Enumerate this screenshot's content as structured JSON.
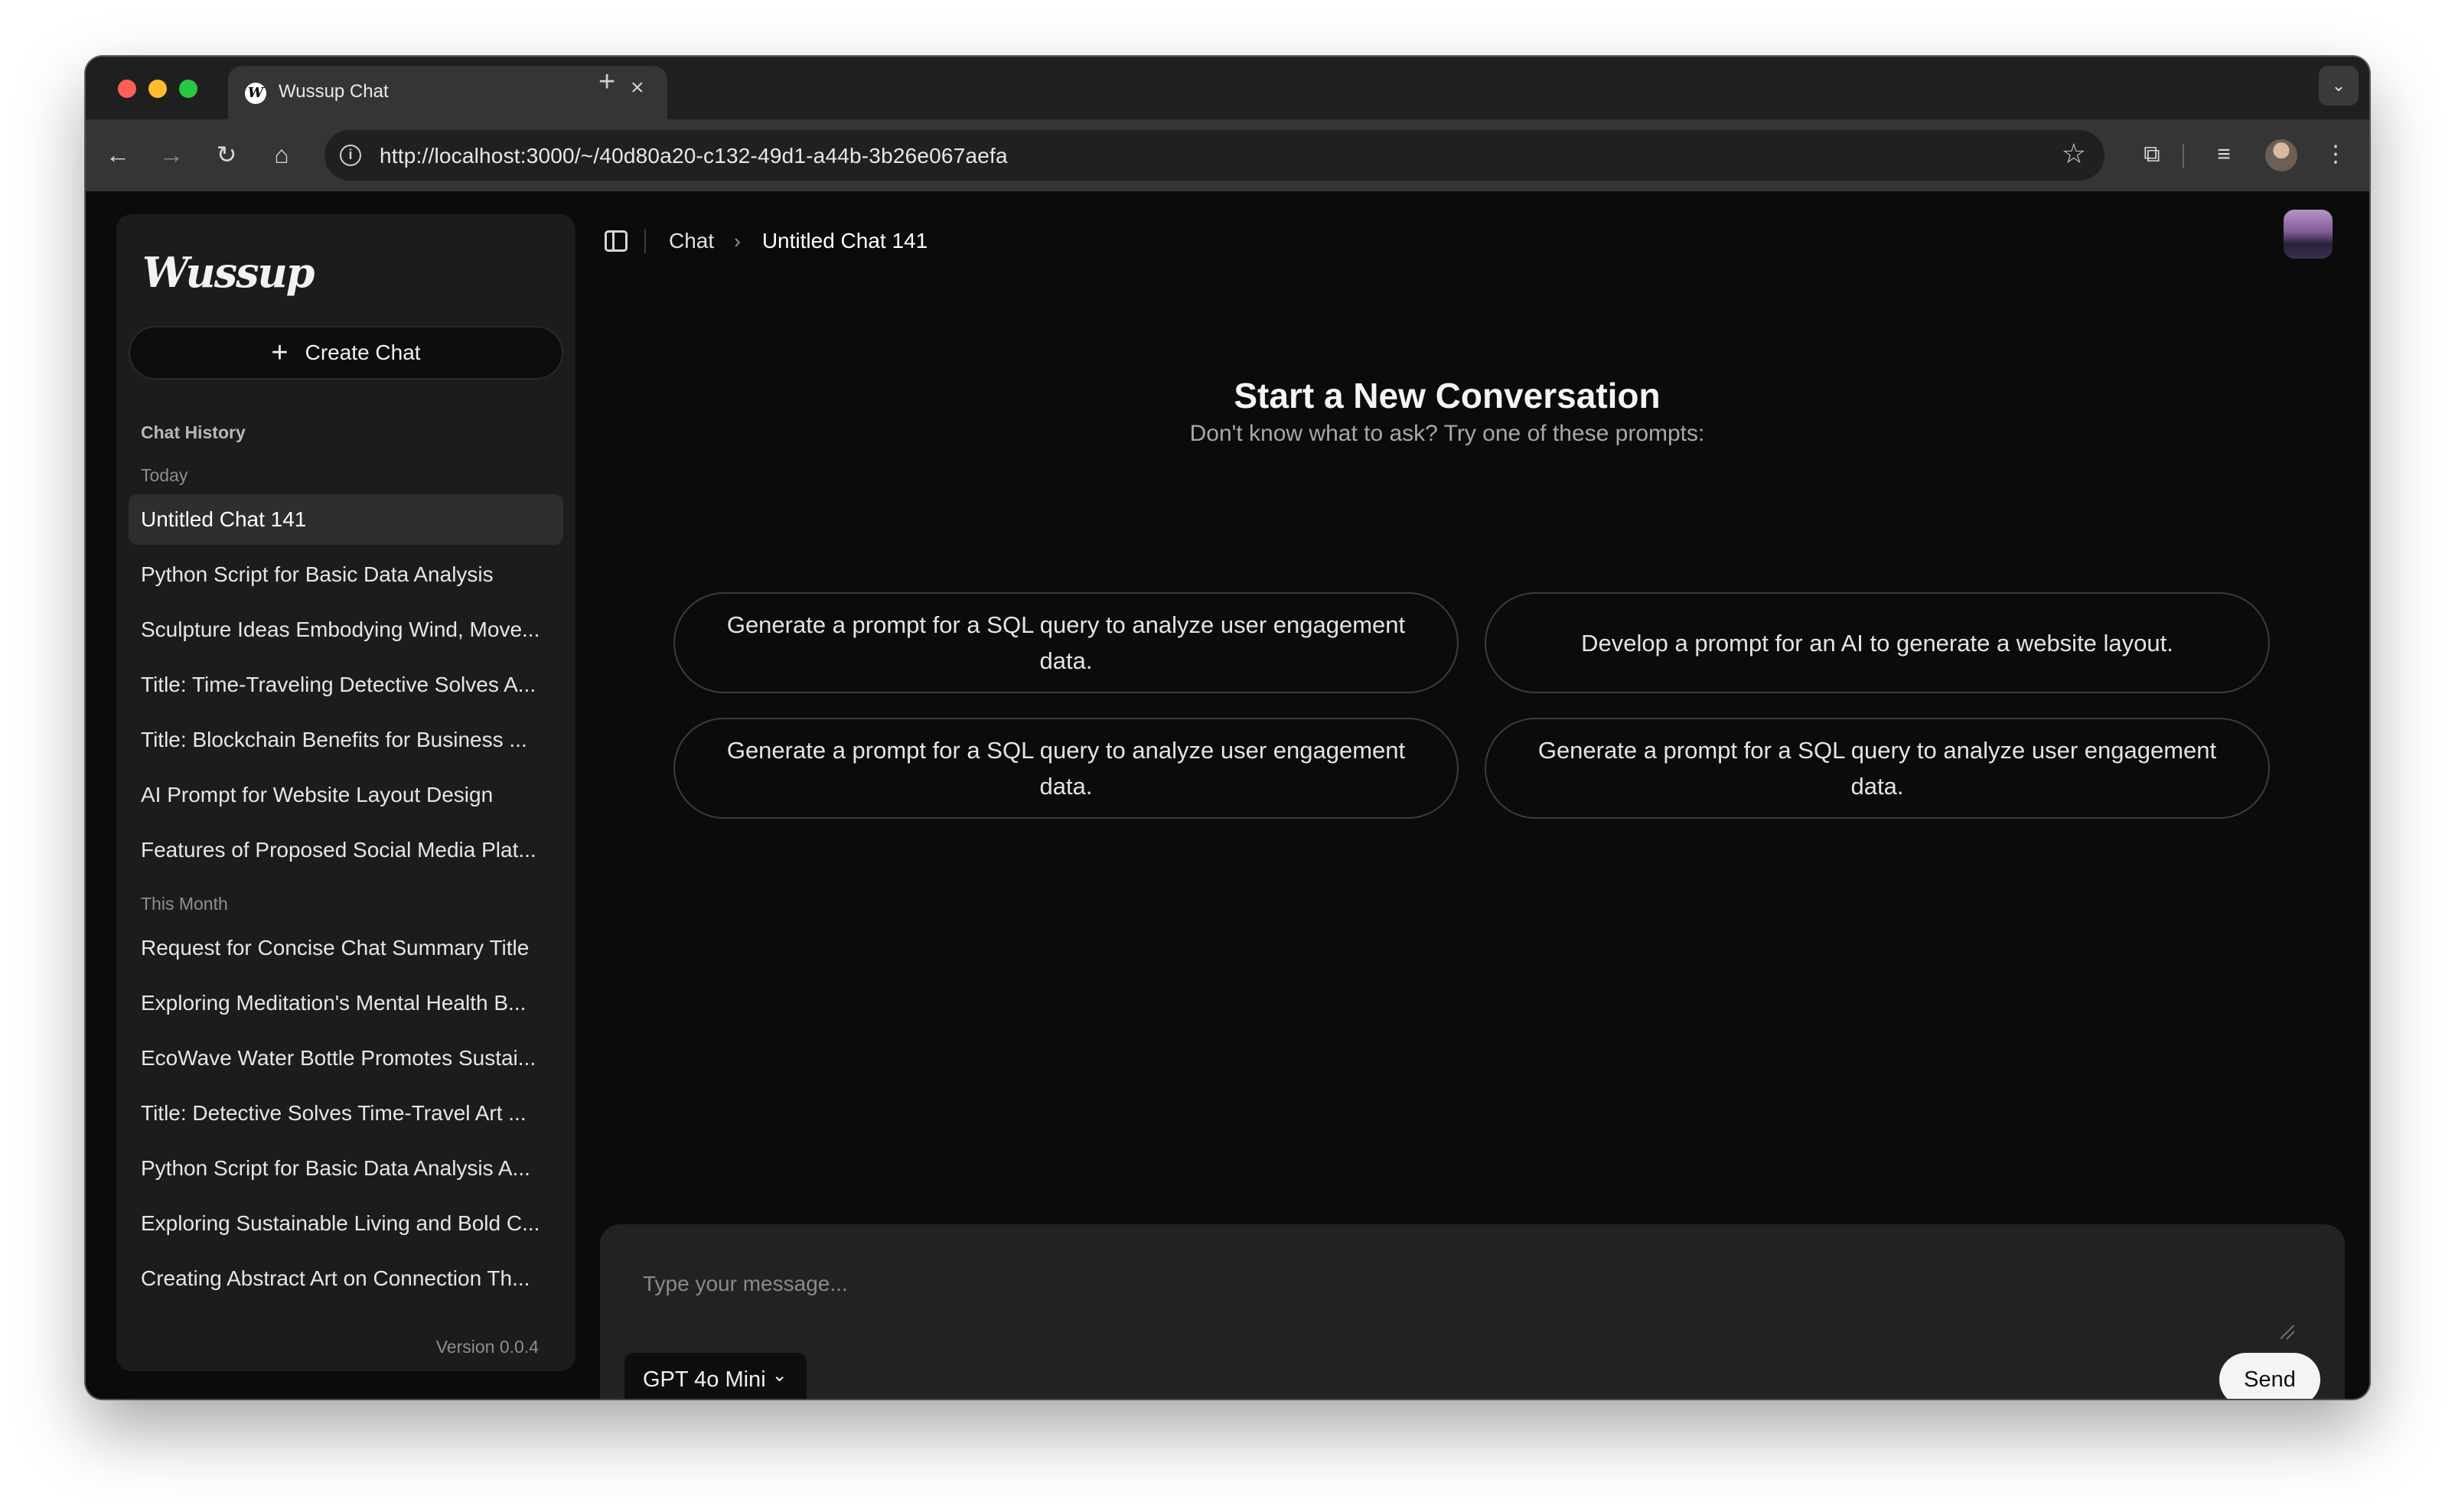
{
  "browser": {
    "tab_title": "Wussup Chat",
    "tab_favicon_letter": "W",
    "close_glyph": "×",
    "new_tab_glyph": "+",
    "tab_menu_glyph": "⌄",
    "info_glyph": "i",
    "url": "http://localhost:3000/~/40d80a20-c132-49d1-a44b-3b26e067aefa",
    "icons": {
      "back": "←",
      "forward": "→",
      "reload": "↻",
      "home": "⌂",
      "star": "☆",
      "extensions": "⧉",
      "media": "≡",
      "menu": "⋮"
    }
  },
  "sidebar": {
    "logo": "Wussup",
    "create_label": "Create Chat",
    "create_glyph": "+",
    "history_title": "Chat History",
    "groups": [
      {
        "title": "Today",
        "items": [
          "Untitled Chat 141",
          "Python Script for Basic Data Analysis",
          "Sculpture Ideas Embodying Wind, Move...",
          "Title: Time-Traveling Detective Solves A...",
          "Title: Blockchain Benefits for Business ...",
          "AI Prompt for Website Layout Design",
          "Features of Proposed Social Media Plat..."
        ]
      },
      {
        "title": "This Month",
        "items": [
          "Request for Concise Chat Summary Title",
          "Exploring Meditation's Mental Health B...",
          "EcoWave Water Bottle Promotes Sustai...",
          "Title: Detective Solves Time-Travel Art ...",
          "Python Script for Basic Data Analysis A...",
          "Exploring Sustainable Living and Bold C...",
          "Creating Abstract Art on Connection Th..."
        ]
      }
    ],
    "version": "Version 0.0.4"
  },
  "header": {
    "crumb_root": "Chat",
    "crumb_separator": "›",
    "crumb_current": "Untitled Chat 141"
  },
  "welcome": {
    "title": "Start a New Conversation",
    "subtitle": "Don't know what to ask? Try one of these prompts:",
    "prompts": [
      "Generate a prompt for a SQL query to analyze user engagement data.",
      "Develop a prompt for an AI to generate a website layout.",
      "Generate a prompt for a SQL query to analyze user engagement data.",
      "Generate a prompt for a SQL query to analyze user engagement data."
    ]
  },
  "composer": {
    "placeholder": "Type your message...",
    "model": "GPT 4o Mini",
    "model_chevron": "⌄",
    "send_label": "Send"
  }
}
